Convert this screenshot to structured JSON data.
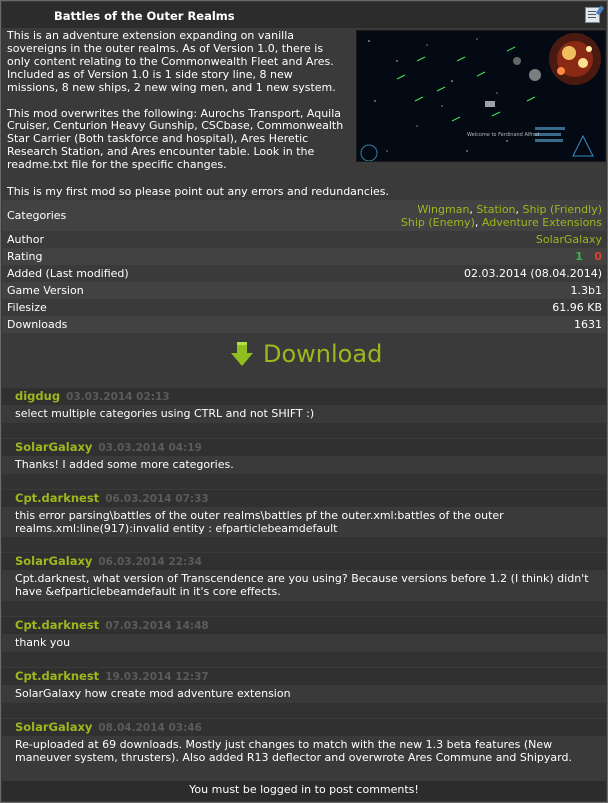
{
  "title": "Battles of the Outer Realms",
  "description": {
    "p1": "This is an adventure extension expanding on vanilla soverеigns in the outer realms. As of Version 1.0, there is only content relating to the Commonwealth Fleet and Ares. Included as of Version 1.0 is 1 side story line, 8 new missions, 8 new ships, 2 new wing men, and 1 new system.",
    "p2": "This mod overwrites the following: Aurochs Transport, Aquila Cruiser, Centurion Heavy Gunship, CSCbase, Commonwealth Star Carrier (Both taskforce and hospital), Ares Heretic Research Station, and Ares encounter table. Look in the readme.txt file for the specific changes.",
    "p3": "This is my first mod so please point out any errors and redundancies."
  },
  "meta": {
    "categories_label": "Categories",
    "categories": [
      "Wingman",
      "Station",
      "Ship (Friendly)",
      "Ship (Enemy)",
      "Adventure Extensions"
    ],
    "author_label": "Author",
    "author": "SolarGalaxy",
    "rating_label": "Rating",
    "rating_up": "1",
    "rating_down": "0",
    "added_label": "Added (Last modified)",
    "added": "02.03.2014 (08.04.2014)",
    "version_label": "Game Version",
    "version": "1.3b1",
    "filesize_label": "Filesize",
    "filesize": "61.96 KB",
    "downloads_label": "Downloads",
    "downloads": "1631"
  },
  "download_label": "Download",
  "comments": [
    {
      "author": "digdug",
      "date": "03.03.2014 02:13",
      "text": "select multiple categories using CTRL and not SHIFT :)"
    },
    {
      "author": "SolarGalaxy",
      "date": "03.03.2014 04:19",
      "text": "Thanks! I added some more categories."
    },
    {
      "author": "Cpt.darknest",
      "date": "06.03.2014 07:33",
      "text": "this error parsing\\battles of the outer realms\\battles pf the outer.xml:battles of the outer realms.xml:line(917):invalid entity : efparticlebeamdefault"
    },
    {
      "author": "SolarGalaxy",
      "date": "06.03.2014 22:34",
      "text": "Cpt.darknest, what version of Transcendence are you using? Because versions before 1.2 (I think) didn't have &efparticlebeamdefault in it's core effects."
    },
    {
      "author": "Cpt.darknest",
      "date": "07.03.2014 14:48",
      "text": "thank you"
    },
    {
      "author": "Cpt.darknest",
      "date": "19.03.2014 12:37",
      "text": "SolarGalaxy how create mod adventure extension"
    },
    {
      "author": "SolarGalaxy",
      "date": "08.04.2014 03:46",
      "text": "Re-uploaded at 69 downloads. Mostly just changes to match with the new 1.3 beta features (New maneuver system, thrusters). Also added R13 deflector and overwrote Ares Commune and Shipyard."
    }
  ],
  "footer": "You must be logged in to post comments!",
  "colors": {
    "link": "#9cb81d",
    "rating_up": "#3bb54a",
    "rating_down": "#e0402e"
  },
  "screenshot_caption": "Welcome to Ferdinand Alfred"
}
